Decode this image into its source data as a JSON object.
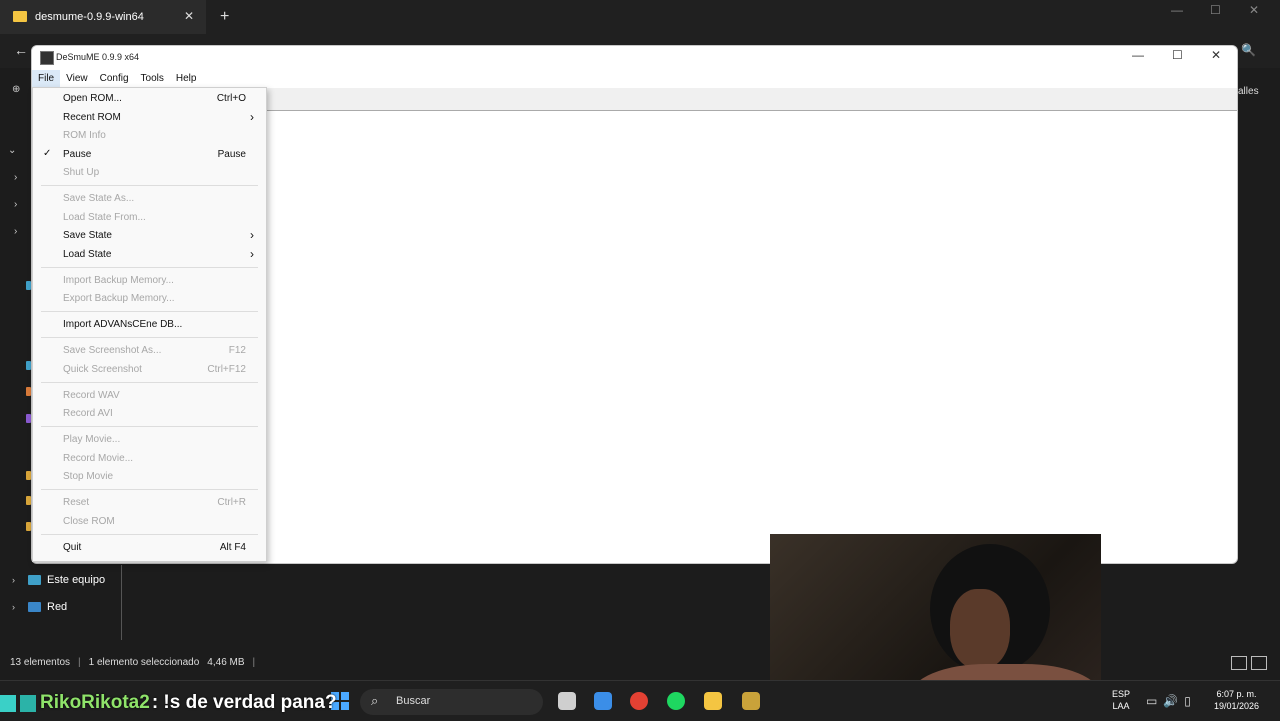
{
  "explorer": {
    "tab_title": "desmume-0.9.9-win64",
    "close_glyph": "✕",
    "new_tab_glyph": "+",
    "details_label": "alles",
    "tree_items": [
      {
        "label": "Este equipo",
        "icon": "computer-icon"
      },
      {
        "label": "Red",
        "icon": "network-icon"
      }
    ],
    "status": {
      "count": "13 elementos",
      "selection": "1 elemento seleccionado",
      "size": "4,46 MB"
    }
  },
  "desmume": {
    "title": "DeSmuME 0.9.9 x64",
    "menus": [
      "File",
      "View",
      "Config",
      "Tools",
      "Help"
    ],
    "active_menu": "File",
    "file_menu": [
      {
        "label": "Open ROM...",
        "accel": "Ctrl+O",
        "enabled": true
      },
      {
        "label": "Recent ROM",
        "submenu": true,
        "enabled": true
      },
      {
        "label": "ROM Info",
        "enabled": false
      },
      {
        "label": "Pause",
        "accel": "Pause",
        "checked": true,
        "enabled": true
      },
      {
        "label": "Shut Up",
        "enabled": false
      },
      {
        "separator": true
      },
      {
        "label": "Save State As...",
        "enabled": false
      },
      {
        "label": "Load State From...",
        "enabled": false
      },
      {
        "label": "Save State",
        "submenu": true,
        "enabled": true
      },
      {
        "label": "Load State",
        "submenu": true,
        "enabled": true
      },
      {
        "separator": true
      },
      {
        "label": "Import Backup Memory...",
        "enabled": false
      },
      {
        "label": "Export Backup Memory...",
        "enabled": false
      },
      {
        "separator": true
      },
      {
        "label": "Import ADVANsCEne DB...",
        "enabled": true
      },
      {
        "separator": true
      },
      {
        "label": "Save Screenshot As...",
        "accel": "F12",
        "enabled": false
      },
      {
        "label": "Quick Screenshot",
        "accel": "Ctrl+F12",
        "enabled": false
      },
      {
        "separator": true
      },
      {
        "label": "Record WAV",
        "enabled": false
      },
      {
        "label": "Record AVI",
        "enabled": false
      },
      {
        "separator": true
      },
      {
        "label": "Play Movie...",
        "enabled": false
      },
      {
        "label": "Record Movie...",
        "enabled": false
      },
      {
        "label": "Stop Movie",
        "enabled": false
      },
      {
        "separator": true
      },
      {
        "label": "Reset",
        "accel": "Ctrl+R",
        "enabled": false
      },
      {
        "label": "Close ROM",
        "enabled": false
      },
      {
        "separator": true
      },
      {
        "label": "Quit",
        "accel": "Alt F4",
        "enabled": true
      }
    ]
  },
  "overlay": {
    "chat_user": "RikoRikota2",
    "chat_message": " : !s de verdad pana?"
  },
  "taskbar": {
    "search_placeholder": "Buscar",
    "lang_top": "ESP",
    "lang_bottom": "LAA",
    "time": "6:07 p. m.",
    "date": "19/01/2026",
    "pinned": [
      {
        "name": "task-view-icon",
        "color": "#cfcfcf"
      },
      {
        "name": "store-icon",
        "color": "#3b8ee8"
      },
      {
        "name": "chrome-icon",
        "color": "#e34133"
      },
      {
        "name": "spotify-icon",
        "color": "#1ed760"
      },
      {
        "name": "file-explorer-icon",
        "color": "#f4c542"
      },
      {
        "name": "league-icon",
        "color": "#c9a23a"
      }
    ]
  }
}
